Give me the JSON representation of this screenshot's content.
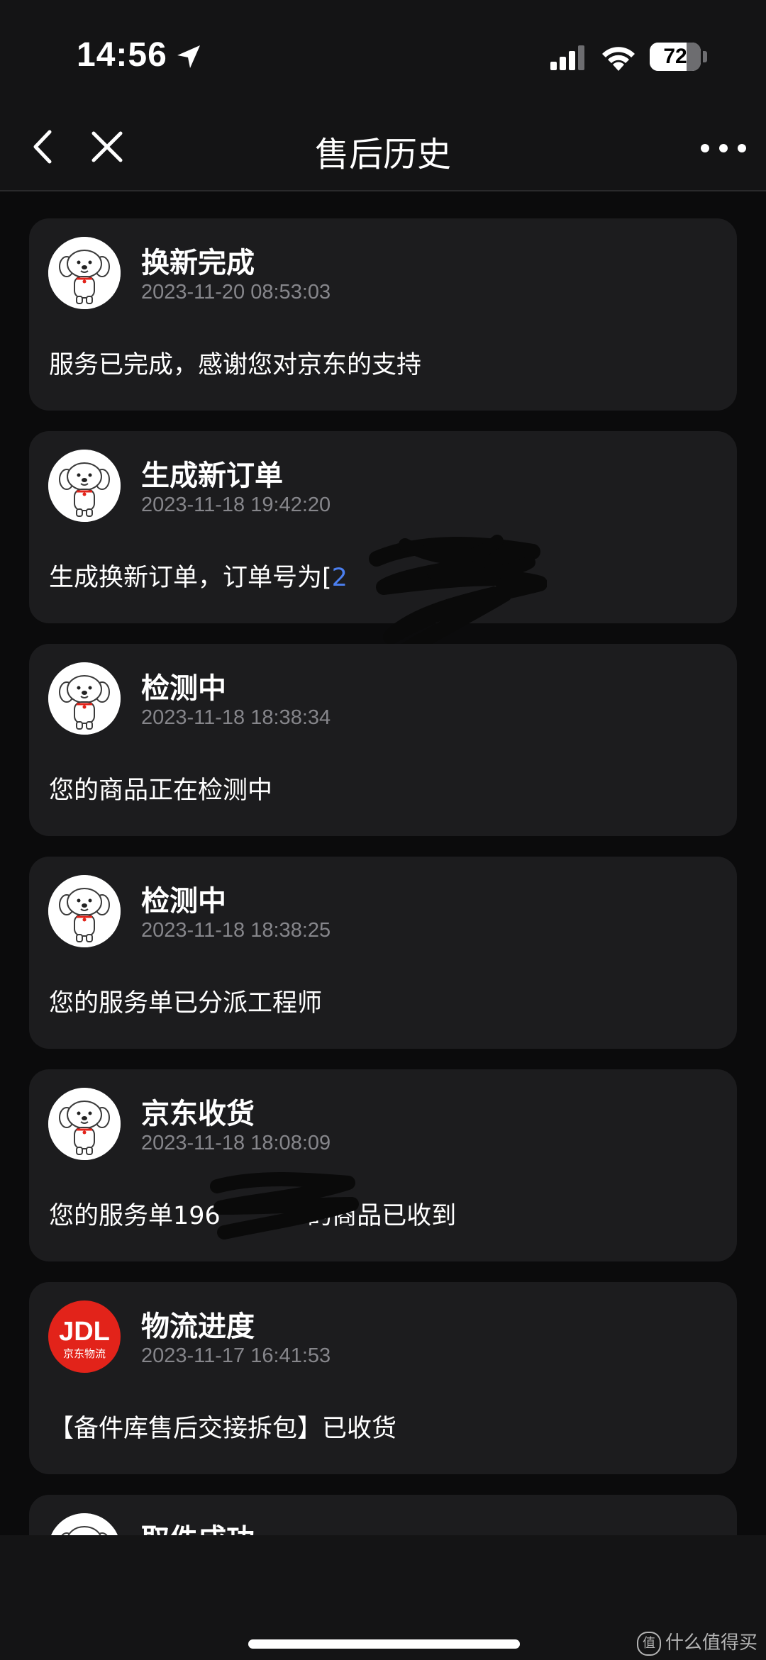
{
  "status_bar": {
    "time": "14:56",
    "battery_level": "72",
    "battery_fraction": 0.72,
    "icons": [
      "location-arrow-icon",
      "cellular-signal-icon",
      "wifi-icon",
      "battery-icon"
    ]
  },
  "nav": {
    "title": "售后历史",
    "back_icon": "chevron-left-icon",
    "close_icon": "close-icon",
    "more_icon": "more-horizontal-icon"
  },
  "history": [
    {
      "title": "换新完成",
      "time": "2023-11-20 08:53:03",
      "desc_prefix": "服务已完成，感谢您对京东的支持",
      "avatar": "jd-dog-mascot-icon"
    },
    {
      "title": "生成新订单",
      "time": "2023-11-18 19:42:20",
      "desc_prefix": "生成换新订单，订单号为[",
      "desc_link": "2                0",
      "desc_suffix": "]",
      "avatar": "jd-dog-mascot-icon"
    },
    {
      "title": "检测中",
      "time": "2023-11-18 18:38:34",
      "desc_prefix": "您的商品正在检测中",
      "avatar": "jd-dog-mascot-icon"
    },
    {
      "title": "检测中",
      "time": "2023-11-18 18:38:25",
      "desc_prefix": "您的服务单已分派工程师",
      "avatar": "jd-dog-mascot-icon"
    },
    {
      "title": "京东收货",
      "time": "2023-11-18 18:08:09",
      "desc_prefix": "您的服务单196         0的商品已收到",
      "avatar": "jd-dog-mascot-icon"
    },
    {
      "title": "物流进度",
      "time": "2023-11-17 16:41:53",
      "desc_prefix": "【备件库售后交接拆包】已收货",
      "avatar": "jdl-logo-icon",
      "avatar_text": "JDL",
      "avatar_subtext": "京东物流"
    },
    {
      "title": "取件成功",
      "time": "",
      "desc_prefix": "",
      "avatar": "jd-dog-mascot-icon"
    }
  ],
  "watermark": "什么值得买",
  "colors": {
    "background": "#0b0b0c",
    "bar": "#141415",
    "card": "#1c1c1e",
    "text_secondary": "#86868b",
    "link": "#4b7ff0",
    "jdl_red": "#e2231a"
  }
}
